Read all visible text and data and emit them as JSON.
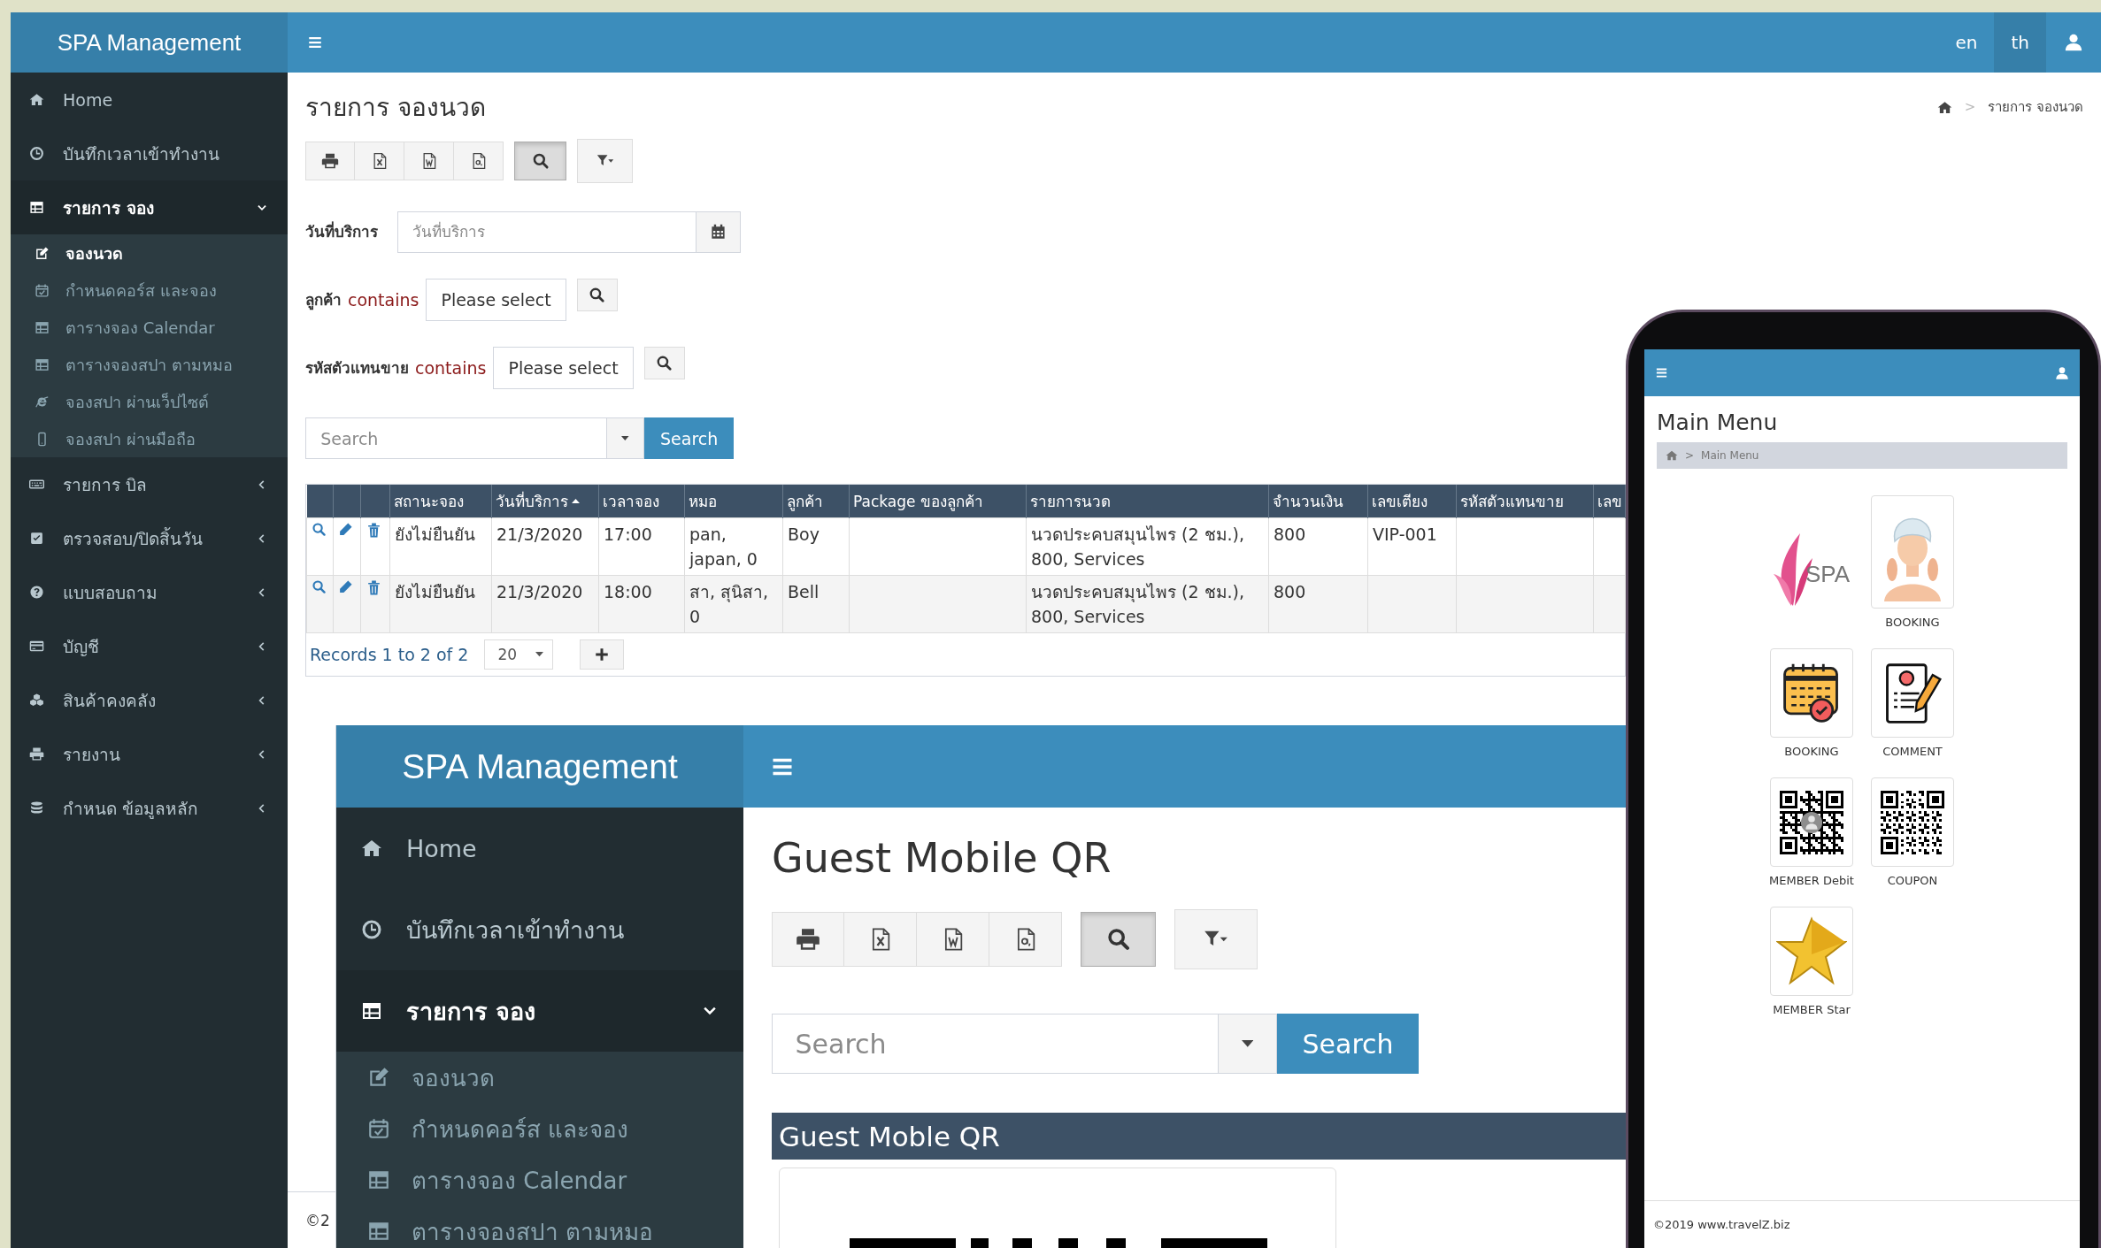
{
  "app": {
    "brand": "SPA Management",
    "languages": [
      {
        "label": "en",
        "selected": false
      },
      {
        "label": "th",
        "selected": true
      }
    ],
    "sidebar": {
      "items": [
        {
          "label": "Home",
          "selected": false
        },
        {
          "label": "บันทึกเวลาเข้าทำงาน",
          "selected": false
        },
        {
          "label": "รายการ จอง",
          "selected": true,
          "expanded": true,
          "children": [
            {
              "label": "จองนวด",
              "selected": true
            },
            {
              "label": "กำหนดคอร์ส และจอง",
              "selected": false
            },
            {
              "label": "ตารางจอง Calendar",
              "selected": false
            },
            {
              "label": "ตารางจองสปา ตามหมอ",
              "selected": false
            },
            {
              "label": "จองสปา ผ่านเว็ปไซต์",
              "selected": false
            },
            {
              "label": "จองสปา ผ่านมือถือ",
              "selected": false
            }
          ]
        },
        {
          "label": "รายการ บิล",
          "selected": false,
          "expanded": false
        },
        {
          "label": "ตรวจสอบ/ปิดสิ้นวัน",
          "selected": false,
          "expanded": false
        },
        {
          "label": "แบบสอบถาม",
          "selected": false,
          "expanded": false
        },
        {
          "label": "บัญชี",
          "selected": false,
          "expanded": false
        },
        {
          "label": "สินค้าคงคลัง",
          "selected": false,
          "expanded": false
        },
        {
          "label": "รายงาน",
          "selected": false,
          "expanded": false
        },
        {
          "label": "กำหนด ข้อมูลหลัก",
          "selected": false,
          "expanded": false
        }
      ]
    },
    "page_title": "รายการ จองนวด",
    "breadcrumb": {
      "separator": ">",
      "current": "รายการ จองนวด"
    },
    "toolbar": {
      "search_toggle": {
        "on": true
      }
    },
    "filters": [
      {
        "kind": "date",
        "label": "วันที่บริการ",
        "placeholder": "วันที่บริการ"
      },
      {
        "kind": "select",
        "label": "ลูกค้า",
        "operator": "contains",
        "value": "Please select"
      },
      {
        "kind": "select",
        "label": "รหัสตัวแทนขาย",
        "operator": "contains",
        "value": "Please select"
      }
    ],
    "search": {
      "placeholder": "Search",
      "button": "Search"
    },
    "table": {
      "columns": [
        {
          "label": "สถานะจอง"
        },
        {
          "label": "วันที่บริการ",
          "sorted_ascending": true
        },
        {
          "label": "เวลาจอง"
        },
        {
          "label": "หมอ"
        },
        {
          "label": "ลูกค้า"
        },
        {
          "label": "Package ของลูกค้า"
        },
        {
          "label": "รายการนวด"
        },
        {
          "label": "จำนวนเงิน"
        },
        {
          "label": "เลขเตียง"
        },
        {
          "label": "รหัสตัวแทนขาย"
        },
        {
          "label": "เลข"
        }
      ],
      "rows": [
        {
          "status": "ยังไม่ยืนยัน",
          "date": "21/3/2020",
          "time": "17:00",
          "therapist": "pan, japan, 0",
          "customer": "Boy",
          "treatment": "นวดประคบสมุนไพร (2 ชม.), 800, Services",
          "amount": "800",
          "bed": "VIP-001"
        },
        {
          "status": "ยังไม่ยืนยัน",
          "date": "21/3/2020",
          "time": "18:00",
          "therapist": "สา, สุนิสา, 0",
          "customer": "Bell",
          "treatment": "นวดประคบสมุนไพร (2 ชม.), 800, Services",
          "amount": "800"
        }
      ]
    },
    "pagination": {
      "summary": "Records 1 to 2 of 2",
      "page_size": "20"
    },
    "footer": "©2"
  },
  "inset": {
    "brand": "SPA Management",
    "sidebar": {
      "items": [
        {
          "label": "Home",
          "selected": false
        },
        {
          "label": "บันทึกเวลาเข้าทำงาน",
          "selected": false
        },
        {
          "label": "รายการ จอง",
          "selected": true,
          "expanded": true,
          "children": [
            {
              "label": "จองนวด",
              "selected": false
            },
            {
              "label": "กำหนดคอร์ส และจอง",
              "selected": false
            },
            {
              "label": "ตารางจอง Calendar",
              "selected": false
            },
            {
              "label": "ตารางจองสปา ตามหมอ",
              "selected": false
            }
          ]
        }
      ]
    },
    "page_title": "Guest Mobile QR",
    "toolbar": {
      "search_toggle": {
        "on": true
      }
    },
    "search": {
      "placeholder": "Search",
      "button": "Search"
    },
    "panel_title": "Guest Moble QR"
  },
  "phone": {
    "title": "Main Menu",
    "breadcrumb": {
      "separator": ">",
      "current": "Main Menu"
    },
    "tiles": [
      {
        "kind": "logo",
        "logo_text": "SPA"
      },
      {
        "kind": "spa-client",
        "label": "BOOKING"
      },
      {
        "kind": "calendar",
        "label": "BOOKING"
      },
      {
        "kind": "document",
        "label": "COMMENT"
      },
      {
        "kind": "member-qr",
        "label": "MEMBER Debit"
      },
      {
        "kind": "qr",
        "label": "COUPON"
      },
      {
        "kind": "star",
        "label": "MEMBER Star"
      }
    ],
    "footer": "©2019 www.travelZ.biz"
  }
}
